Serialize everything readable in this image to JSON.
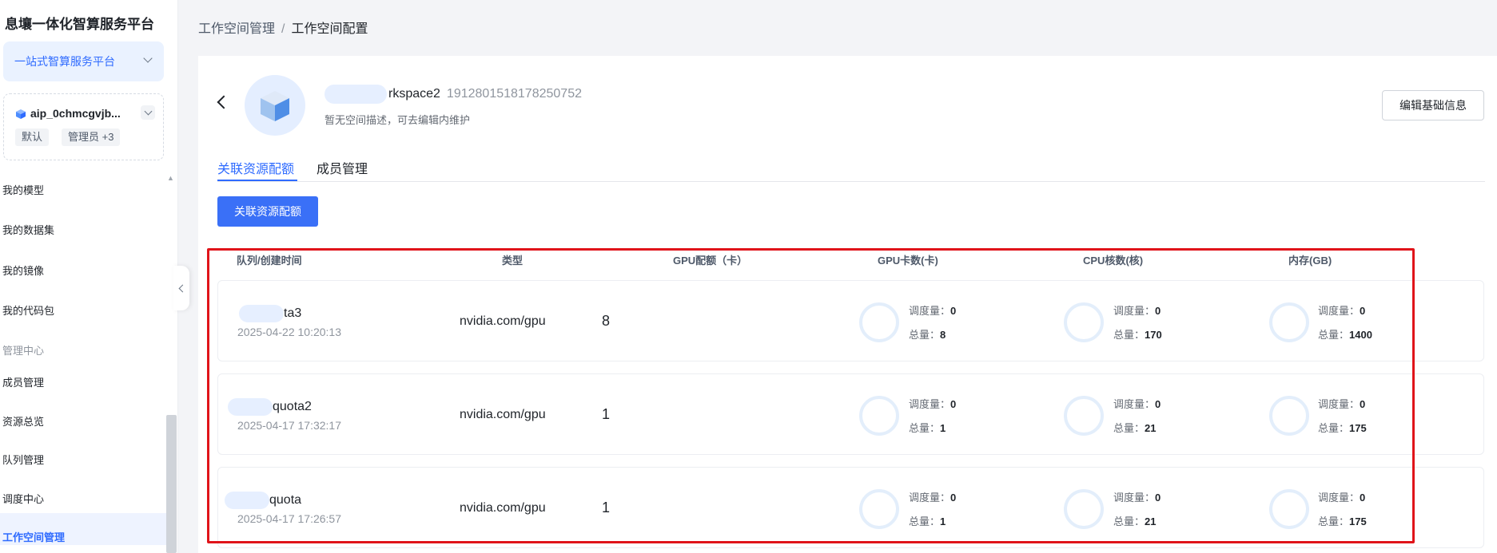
{
  "sidebar": {
    "app_title": "息壤一体化智算服务平台",
    "platform_select": "一站式智算服务平台",
    "workspace": {
      "name": "aip_0chmcgvjb...",
      "tag_default": "默认",
      "tag_admin": "管理员 +3"
    },
    "items": [
      {
        "label": "我的模型"
      },
      {
        "label": "我的数据集"
      },
      {
        "label": "我的镜像"
      },
      {
        "label": "我的代码包"
      }
    ],
    "section_title": "管理中心",
    "admin_items": [
      {
        "label": "成员管理"
      },
      {
        "label": "资源总览"
      },
      {
        "label": "队列管理"
      },
      {
        "label": "调度中心"
      },
      {
        "label": "工作空间管理"
      }
    ]
  },
  "breadcrumb": {
    "parent": "工作空间管理",
    "separator": "/",
    "current": "工作空间配置"
  },
  "workspace_header": {
    "name_suffix": "rkspace2",
    "id": "1912801518178250752",
    "description": "暂无空间描述，可去编辑内维护",
    "edit_label": "编辑基础信息"
  },
  "tabs": [
    {
      "label": "关联资源配额",
      "active": true
    },
    {
      "label": "成员管理",
      "active": false
    }
  ],
  "primary_action": "关联资源配额",
  "table": {
    "headers": [
      "队列/创建时间",
      "类型",
      "GPU配额（卡）",
      "GPU卡数(卡)",
      "CPU核数(核)",
      "内存(GB)"
    ],
    "stat_labels": {
      "scheduled": "调度量：",
      "total": "总量："
    },
    "rows": [
      {
        "name_suffix": "ta3",
        "created": "2025-04-22 10:20:13",
        "type": "nvidia.com/gpu",
        "gpu_quota": "8",
        "gpu": {
          "scheduled": "0",
          "total": "8"
        },
        "cpu": {
          "scheduled": "0",
          "total": "170"
        },
        "mem": {
          "scheduled": "0",
          "total": "1400"
        }
      },
      {
        "name_suffix": "quota2",
        "created": "2025-04-17 17:32:17",
        "type": "nvidia.com/gpu",
        "gpu_quota": "1",
        "gpu": {
          "scheduled": "0",
          "total": "1"
        },
        "cpu": {
          "scheduled": "0",
          "total": "21"
        },
        "mem": {
          "scheduled": "0",
          "total": "175"
        }
      },
      {
        "name_suffix": "quota",
        "created": "2025-04-17 17:26:57",
        "type": "nvidia.com/gpu",
        "gpu_quota": "1",
        "gpu": {
          "scheduled": "0",
          "total": "1"
        },
        "cpu": {
          "scheduled": "0",
          "total": "21"
        },
        "mem": {
          "scheduled": "0",
          "total": "175"
        }
      }
    ]
  },
  "colors": {
    "accent": "#2f6bff",
    "highlight_box": "#e0141a"
  }
}
